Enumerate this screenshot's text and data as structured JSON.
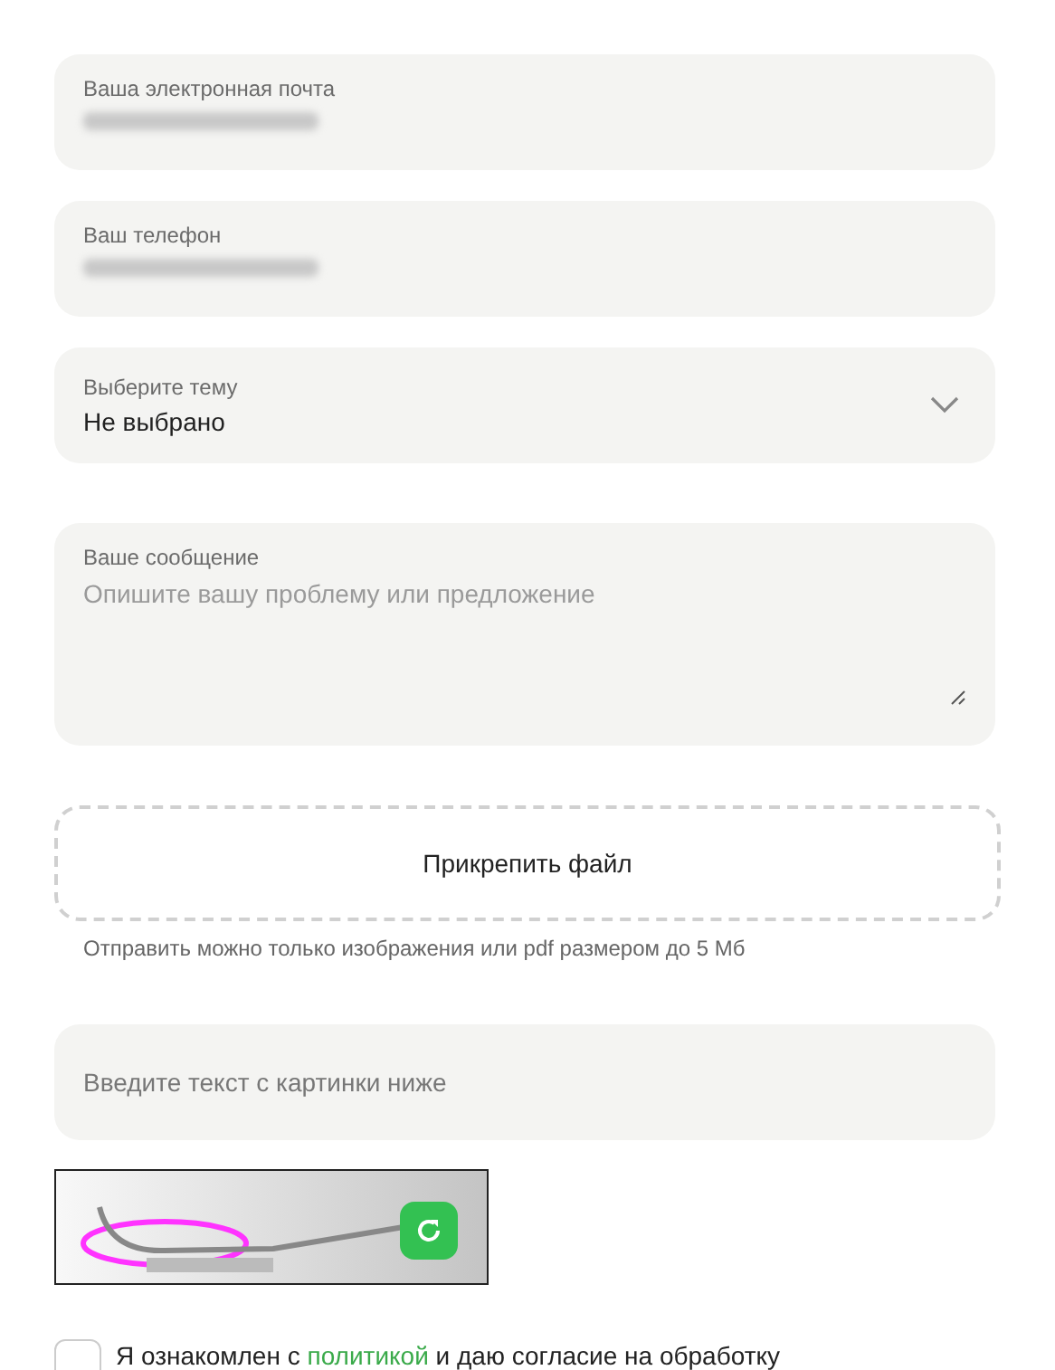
{
  "fields": [
    {
      "kind": "blurred",
      "label": "Ваша электронная почта"
    },
    {
      "kind": "blurred",
      "label": "Ваш телефон"
    },
    {
      "kind": "select",
      "label": "Выберите тему",
      "value": "Не выбрано"
    },
    {
      "kind": "textarea",
      "label": "Ваше сообщение",
      "placeholder": "Опишите вашу проблему или предложение"
    }
  ],
  "attach": {
    "label": "Прикрепить файл",
    "hint": "Отправить можно только изображения или pdf размером до 5 Мб"
  },
  "captcha": {
    "placeholder": "Введите текст с картинки ниже"
  },
  "consent": {
    "checked": false,
    "before": "Я ознакомлен с ",
    "link": "политикой",
    "after": " и даю согласие на обработку"
  }
}
